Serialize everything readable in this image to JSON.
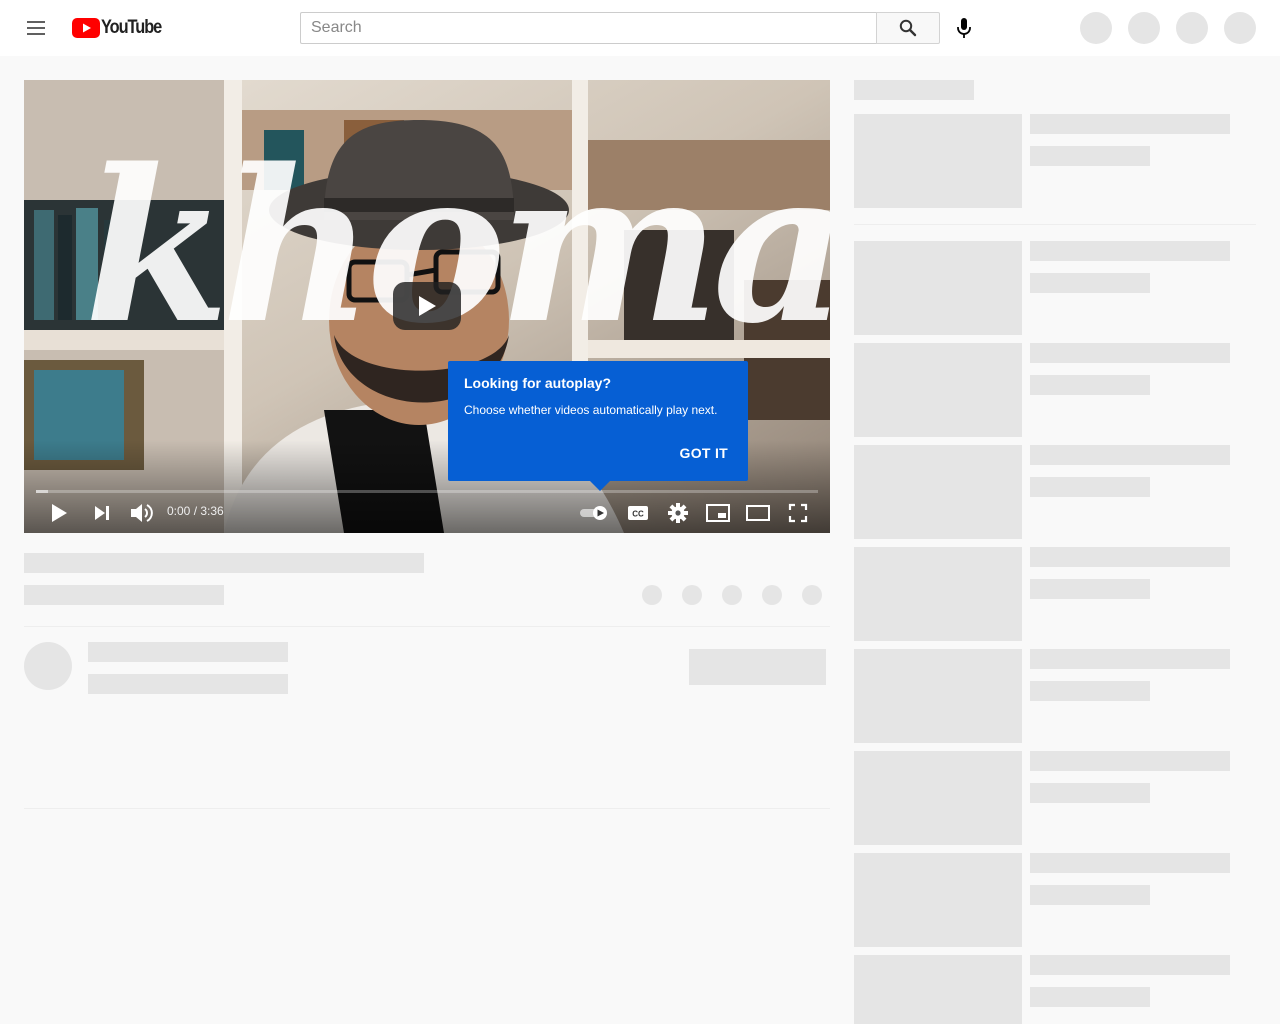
{
  "masthead": {
    "logo_text": "YouTube",
    "search_placeholder": "Search",
    "icons": [
      "menu-icon",
      "search-icon",
      "microphone-icon"
    ],
    "brand_color": "#ff0000"
  },
  "player": {
    "title_overlay": "khoma",
    "time_current": "0:00",
    "time_total": "3:36",
    "time_separator": " / ",
    "progress_fraction": 0.015,
    "controls": [
      "play-icon",
      "next-icon",
      "volume-icon",
      "autoplay-toggle-icon",
      "captions-icon",
      "settings-icon",
      "miniplayer-icon",
      "theater-icon",
      "fullscreen-icon"
    ]
  },
  "tooltip": {
    "title": "Looking for autoplay?",
    "body": "Choose whether videos automatically play next.",
    "button": "GOT IT",
    "color": "#065fd4"
  },
  "colors": {
    "placeholder": "#e5e5e5",
    "page_background": "#f9f9f9"
  }
}
